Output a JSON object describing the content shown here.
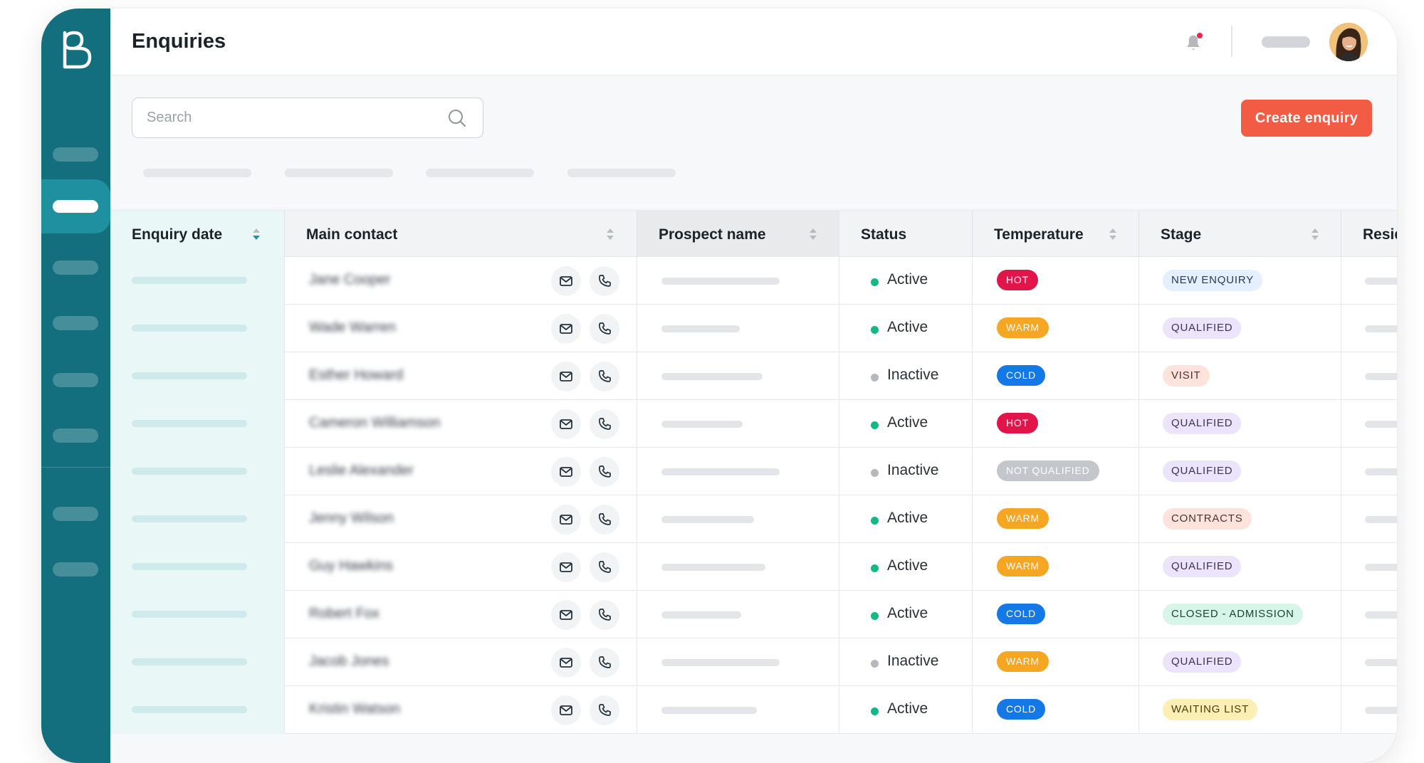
{
  "app": {
    "title": "Enquiries",
    "brand_color": "#136f7d",
    "accent_color": "#f25c45"
  },
  "header": {
    "bell_icon": "bell-icon",
    "has_notification": true
  },
  "search": {
    "placeholder": "Search",
    "value": "",
    "icon": "search-icon"
  },
  "actions": {
    "create_label": "Create enquiry"
  },
  "table": {
    "columns": [
      {
        "label": "Enquiry date",
        "sortable": true,
        "sorted": "desc"
      },
      {
        "label": "Main contact",
        "sortable": true
      },
      {
        "label": "Prospect name",
        "sortable": true
      },
      {
        "label": "Status",
        "sortable": false
      },
      {
        "label": "Temperature",
        "sortable": true
      },
      {
        "label": "Stage",
        "sortable": true
      },
      {
        "label": "Resid",
        "sortable": false
      }
    ],
    "rows": [
      {
        "contact": "Jane Cooper",
        "status": "Active",
        "temperature": "HOT",
        "stage": "NEW ENQUIRY"
      },
      {
        "contact": "Wade Warren",
        "status": "Active",
        "temperature": "WARM",
        "stage": "QUALIFIED"
      },
      {
        "contact": "Esther Howard",
        "status": "Inactive",
        "temperature": "COLD",
        "stage": "VISIT"
      },
      {
        "contact": "Cameron Williamson",
        "status": "Active",
        "temperature": "HOT",
        "stage": "QUALIFIED"
      },
      {
        "contact": "Leslie Alexander",
        "status": "Inactive",
        "temperature": "NOT QUALIFIED",
        "stage": "QUALIFIED"
      },
      {
        "contact": "Jenny Wilson",
        "status": "Active",
        "temperature": "WARM",
        "stage": "CONTRACTS"
      },
      {
        "contact": "Guy Hawkins",
        "status": "Active",
        "temperature": "WARM",
        "stage": "QUALIFIED"
      },
      {
        "contact": "Robert Fox",
        "status": "Active",
        "temperature": "COLD",
        "stage": "CLOSED - ADMISSION"
      },
      {
        "contact": "Jacob Jones",
        "status": "Inactive",
        "temperature": "WARM",
        "stage": "QUALIFIED"
      },
      {
        "contact": "Kristin Watson",
        "status": "Active",
        "temperature": "COLD",
        "stage": "WAITING LIST"
      }
    ]
  },
  "colors": {
    "status": {
      "Active": "#12b886",
      "Inactive": "#b5b9be"
    },
    "temperature": {
      "HOT": {
        "bg": "#e2154a",
        "fg": "#ffffff"
      },
      "WARM": {
        "bg": "#f5a623",
        "fg": "#ffffff"
      },
      "COLD": {
        "bg": "#1478e6",
        "fg": "#ffffff"
      },
      "NOT QUALIFIED": {
        "bg": "#c3c6ca",
        "fg": "#ffffff"
      }
    },
    "stage": {
      "NEW ENQUIRY": {
        "bg": "#e4efff",
        "fg": "#2b3a55"
      },
      "QUALIFIED": {
        "bg": "#ebe4fb",
        "fg": "#3d3550"
      },
      "VISIT": {
        "bg": "#fde3dc",
        "fg": "#4a3330"
      },
      "CONTRACTS": {
        "bg": "#fde3dc",
        "fg": "#4a3330"
      },
      "CLOSED - ADMISSION": {
        "bg": "#d8f5ea",
        "fg": "#1f4237"
      },
      "WAITING LIST": {
        "bg": "#fdefb3",
        "fg": "#4a3d12"
      }
    }
  }
}
